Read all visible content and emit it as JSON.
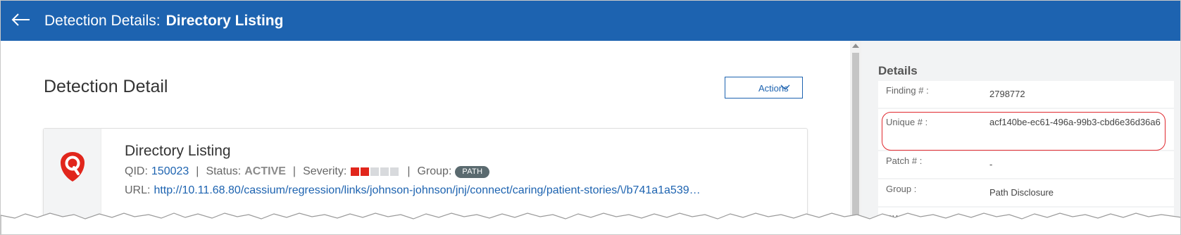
{
  "header": {
    "title_prefix": "Detection Details:",
    "title_name": "Directory Listing",
    "colors": {
      "bar": "#1d63b0",
      "text": "#ffffff"
    },
    "back_icon": "arrow-left-icon"
  },
  "main": {
    "heading": "Detection Detail",
    "actions_label": "Actions",
    "actions_icon": "chevron-down-icon"
  },
  "card": {
    "logo_icon": "qualys-shield-logo",
    "title": "Directory Listing",
    "qid_label": "QID:",
    "qid": "150023",
    "status_label": "Status:",
    "status": "ACTIVE",
    "severity_label": "Severity:",
    "severity_level": 2,
    "severity_max": 5,
    "group_label": "Group:",
    "group": "PATH",
    "url_label": "URL:",
    "url": "http://10.11.68.80/cassium/regression/links/johnson-johnson/jnj/connect/caring/patient-stories/\\/b741a1a539…",
    "colors": {
      "link": "#1d63b0",
      "severity_on": "#e1261c",
      "severity_off": "#d8dadd",
      "badge": "#5a6a6f"
    }
  },
  "details": {
    "title": "Details",
    "rows": [
      {
        "label": "Finding # :",
        "value": "2798772"
      },
      {
        "label": "Unique # :",
        "value": "acf140be-ec61-496a-99b3-cbd6e36d36a6"
      },
      {
        "label": "Patch # :",
        "value": "-"
      },
      {
        "label": "Group :",
        "value": "Path Disclosure"
      },
      {
        "label": "CWE :",
        "value": ""
      }
    ],
    "highlight_color": "#e0282e"
  }
}
